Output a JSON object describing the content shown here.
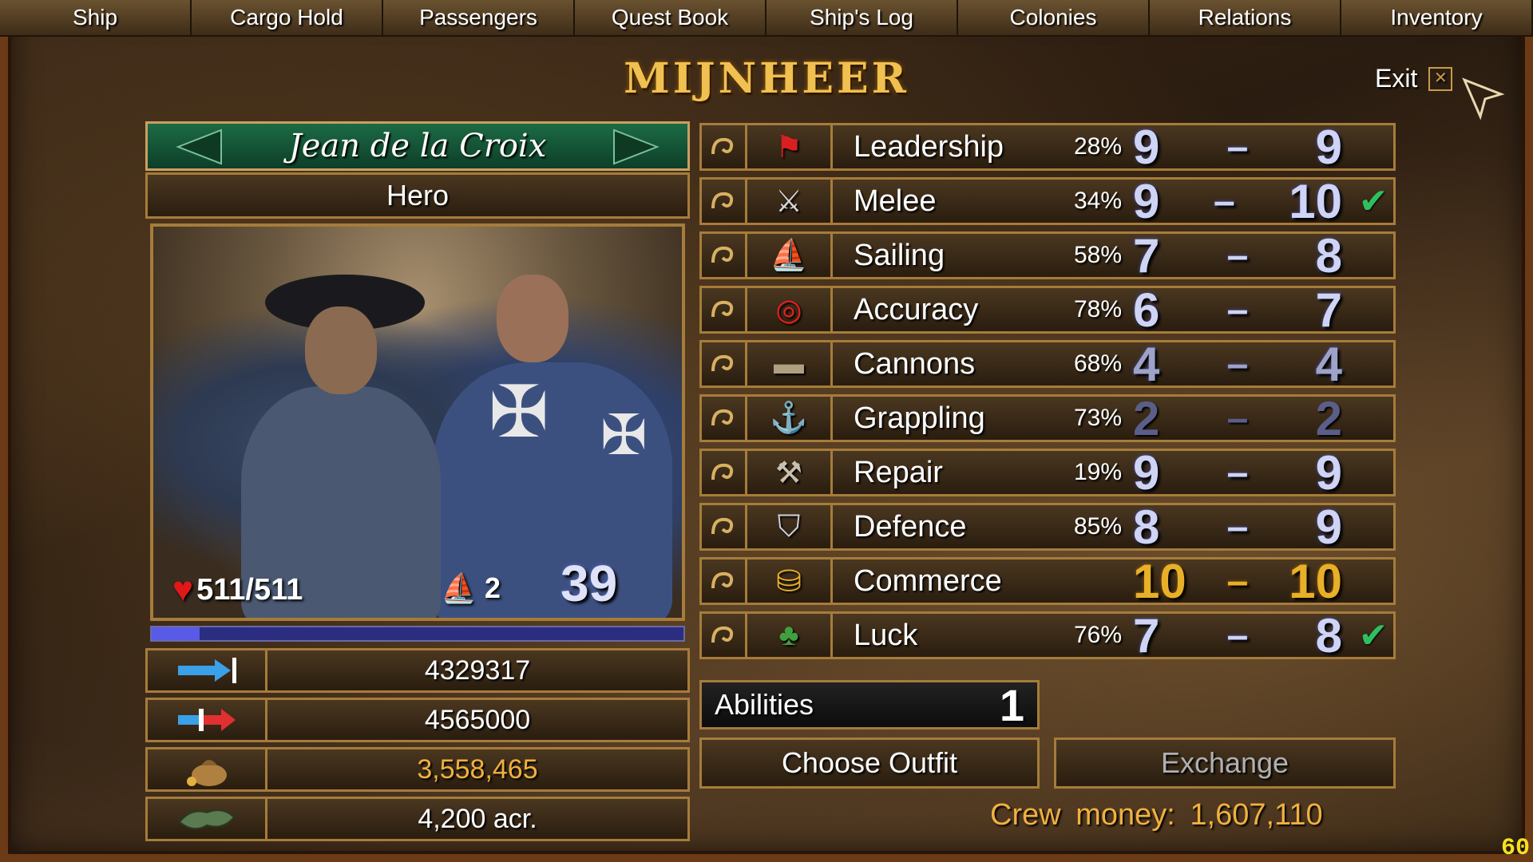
{
  "tabs": [
    "Ship",
    "Cargo Hold",
    "Passengers",
    "Quest Book",
    "Ship's Log",
    "Colonies",
    "Relations",
    "Inventory"
  ],
  "title": "MIJNHEER",
  "exit_label": "Exit",
  "exit_glyph": "✕",
  "character": {
    "name": "Jean de la Croix",
    "role": "Hero",
    "hp": "511/511",
    "ship_count": "2",
    "level": "39",
    "xp_progress_percent": 9
  },
  "left_stats": [
    {
      "icon": "arrow-right-icon",
      "value": "4329317"
    },
    {
      "icon": "arrow-swap-icon",
      "value": "4565000"
    },
    {
      "icon": "money-bag-icon",
      "value": "3,558,465"
    },
    {
      "icon": "land-icon",
      "value": "4,200 acr."
    }
  ],
  "skills": [
    {
      "icon": "flag-icon",
      "name": "Leadership",
      "pct": "28%",
      "base": "9",
      "dash": "–",
      "total": "9",
      "check": ""
    },
    {
      "icon": "swords-icon",
      "name": "Melee",
      "pct": "34%",
      "base": "9",
      "dash": "–",
      "total": "10",
      "check": "✔"
    },
    {
      "icon": "ship-icon",
      "name": "Sailing",
      "pct": "58%",
      "base": "7",
      "dash": "–",
      "total": "8",
      "check": ""
    },
    {
      "icon": "target-icon",
      "name": "Accuracy",
      "pct": "78%",
      "base": "6",
      "dash": "–",
      "total": "7",
      "check": ""
    },
    {
      "icon": "cannon-icon",
      "name": "Cannons",
      "pct": "68%",
      "base": "4",
      "dash": "–",
      "total": "4",
      "check": ""
    },
    {
      "icon": "grapple-icon",
      "name": "Grappling",
      "pct": "73%",
      "base": "2",
      "dash": "–",
      "total": "2",
      "check": ""
    },
    {
      "icon": "hammer-icon",
      "name": "Repair",
      "pct": "19%",
      "base": "9",
      "dash": "–",
      "total": "9",
      "check": ""
    },
    {
      "icon": "shield-icon",
      "name": "Defence",
      "pct": "85%",
      "base": "8",
      "dash": "–",
      "total": "9",
      "check": ""
    },
    {
      "icon": "coins-icon",
      "name": "Commerce",
      "pct": "",
      "base": "10",
      "dash": "–",
      "total": "10",
      "check": ""
    },
    {
      "icon": "clover-icon",
      "name": "Luck",
      "pct": "76%",
      "base": "7",
      "dash": "–",
      "total": "8",
      "check": "✔"
    }
  ],
  "abilities": {
    "label": "Abilities",
    "count": "1"
  },
  "buttons": {
    "choose_outfit": "Choose Outfit",
    "exchange": "Exchange"
  },
  "crew_money": "Crew money: 1,607,110",
  "fps": "60",
  "colors": {
    "gold": "#f0b040",
    "green_banner": "#1c6b45",
    "border": "#a67c3a",
    "stat_digits": "#cfd3f4"
  }
}
